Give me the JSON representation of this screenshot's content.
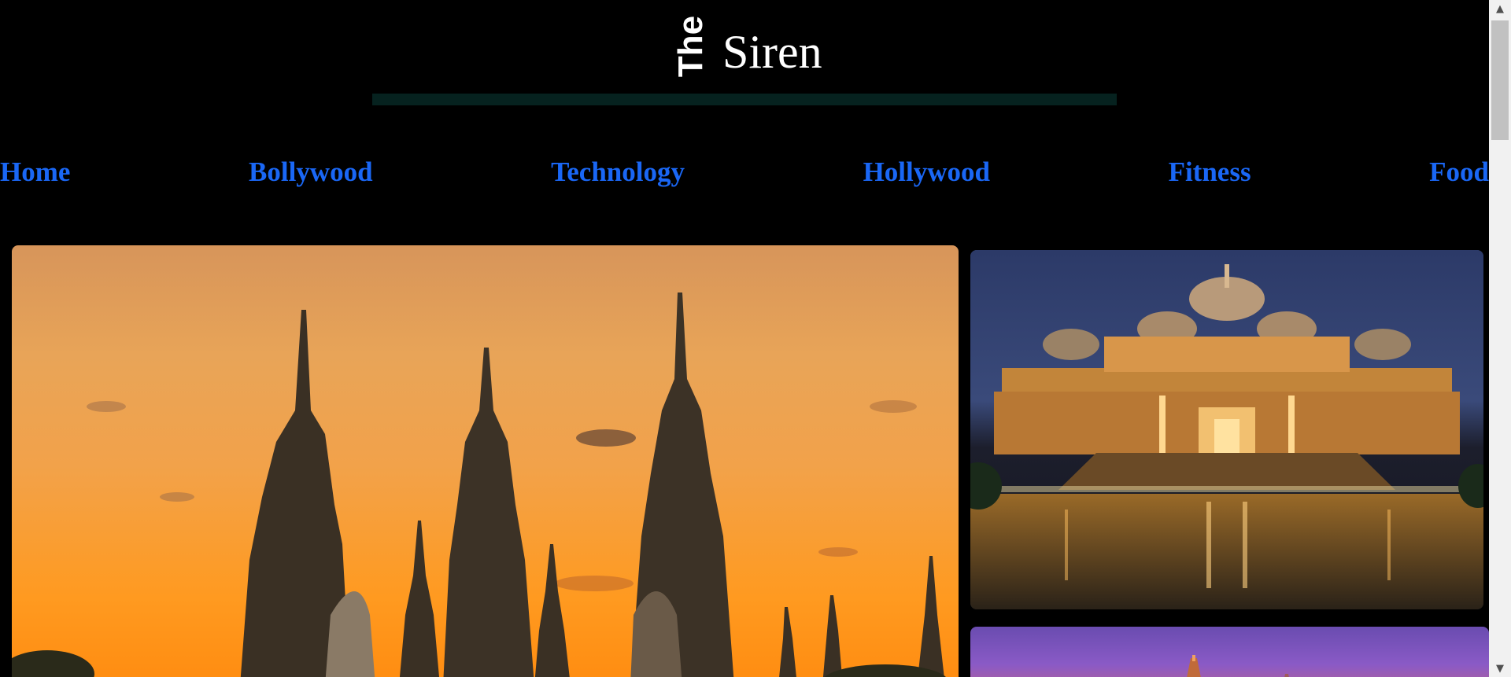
{
  "brand": {
    "the": "The",
    "siren": "Siren"
  },
  "nav": {
    "items": [
      {
        "label": "Home"
      },
      {
        "label": "Bollywood"
      },
      {
        "label": "Technology"
      },
      {
        "label": "Hollywood"
      },
      {
        "label": "Fitness"
      },
      {
        "label": "Food"
      }
    ]
  },
  "colors": {
    "background": "#000000",
    "nav_link": "#1a67f5",
    "rule": "#06221f",
    "logo": "#ffffff"
  },
  "images": {
    "main": "temple-silhouette-sunset-photo",
    "side_1": "illuminated-temple-night-reflection-photo",
    "side_2": "temple-purple-sky-photo"
  },
  "scrollbar": {
    "up_icon": "triangle-up-icon",
    "down_icon": "triangle-down-icon"
  }
}
